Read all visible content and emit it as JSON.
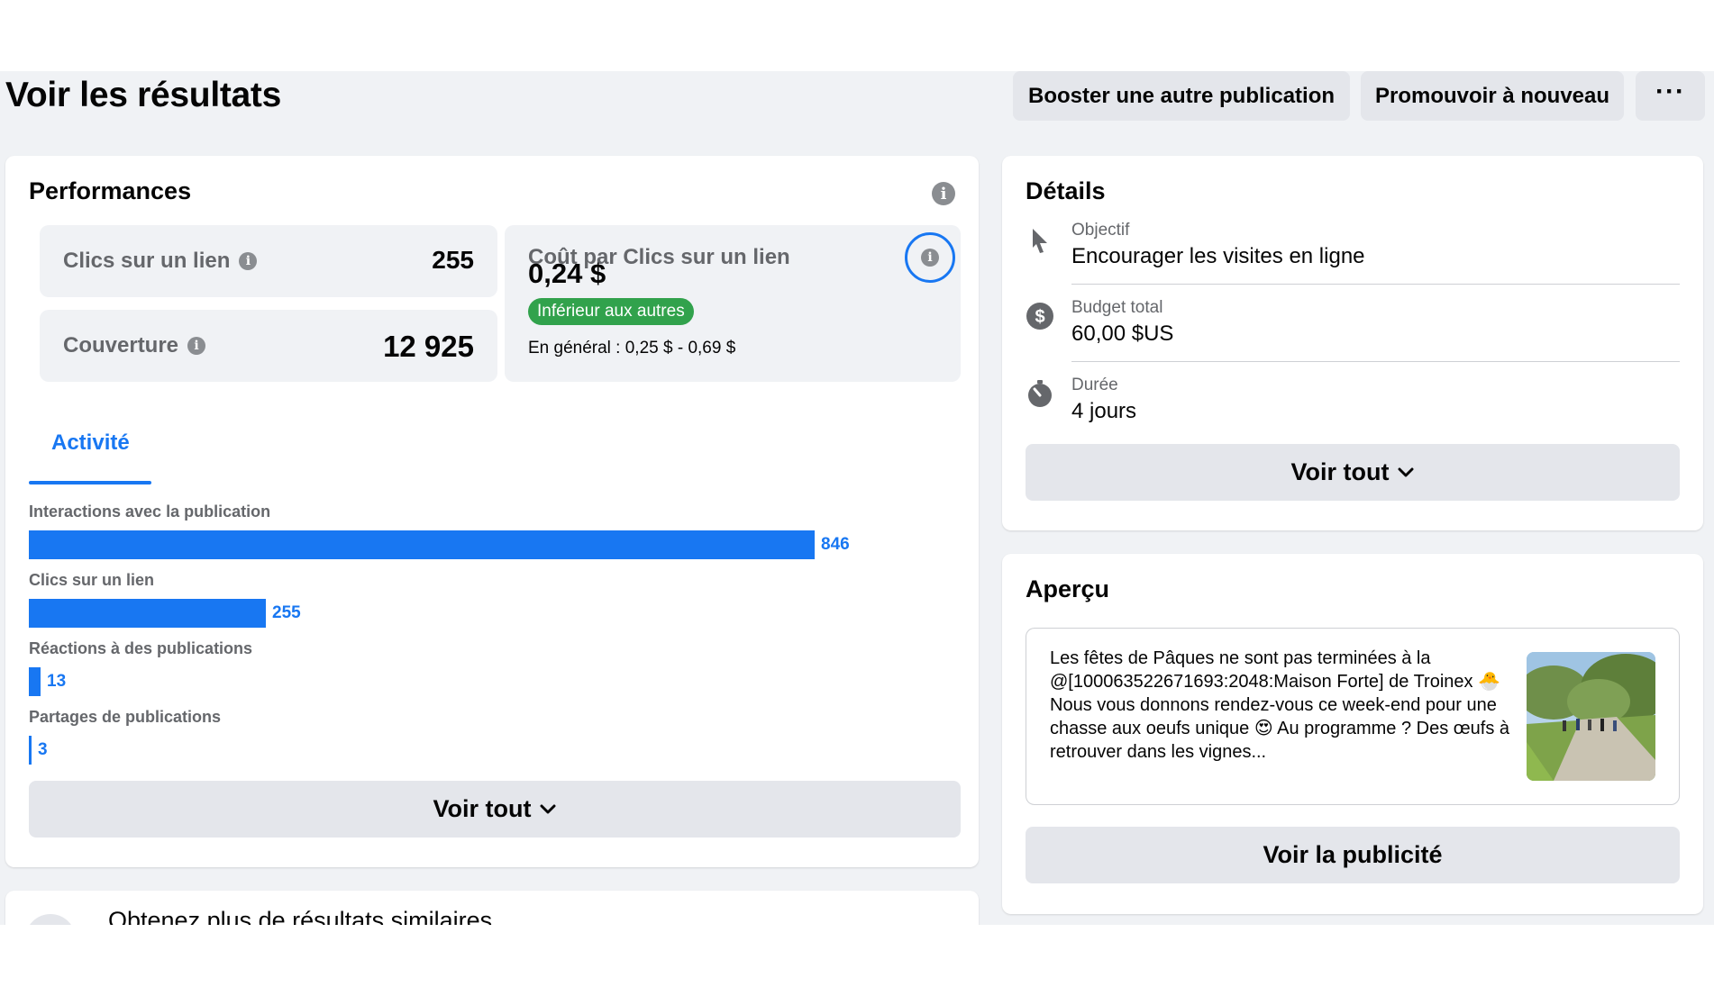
{
  "header": {
    "title": "Voir les résultats",
    "buttons": {
      "boost_other": "Booster une autre publication",
      "promote_again": "Promouvoir à nouveau",
      "more": "···"
    }
  },
  "performance": {
    "title": "Performances",
    "metrics": {
      "link_clicks": {
        "label": "Clics sur un lien",
        "value": "255"
      },
      "reach": {
        "label": "Couverture",
        "value": "12 925"
      },
      "cost": {
        "label": "Coût par Clics sur un lien",
        "value": "0,24 $",
        "badge": "Inférieur aux autres",
        "range": "En général : 0,25 $ - 0,69 $"
      }
    },
    "tab_label": "Activité",
    "activity": [
      {
        "label": "Interactions avec la publication",
        "value": "846",
        "amount": 846
      },
      {
        "label": "Clics sur un lien",
        "value": "255",
        "amount": 255
      },
      {
        "label": "Réactions à des publications",
        "value": "13",
        "amount": 13
      },
      {
        "label": "Partages de publications",
        "value": "3",
        "amount": 3
      }
    ],
    "see_all": "Voir tout"
  },
  "details": {
    "title": "Détails",
    "rows": [
      {
        "icon": "cursor-icon",
        "label": "Objectif",
        "value": "Encourager les visites en ligne"
      },
      {
        "icon": "dollar-icon",
        "label": "Budget total",
        "value": "60,00 $US"
      },
      {
        "icon": "stopwatch-icon",
        "label": "Durée",
        "value": "4 jours"
      }
    ],
    "see_all": "Voir tout"
  },
  "preview": {
    "title": "Aperçu",
    "text": "Les fêtes de Pâques ne sont pas terminées à la @[100063522671693:2048:Maison Forte] de Troinex 🐣 Nous vous donnons rendez-vous ce week-end pour une chasse aux oeufs unique 😍 Au programme ? Des œufs à retrouver dans les vignes...",
    "view_ad": "Voir la publicité"
  },
  "similar": {
    "title": "Obtenez plus de résultats similaires"
  },
  "colors": {
    "accent": "#1877f2",
    "badge_green": "#31a24c",
    "page_bg": "#f0f2f5",
    "button_bg": "#e4e6eb"
  }
}
